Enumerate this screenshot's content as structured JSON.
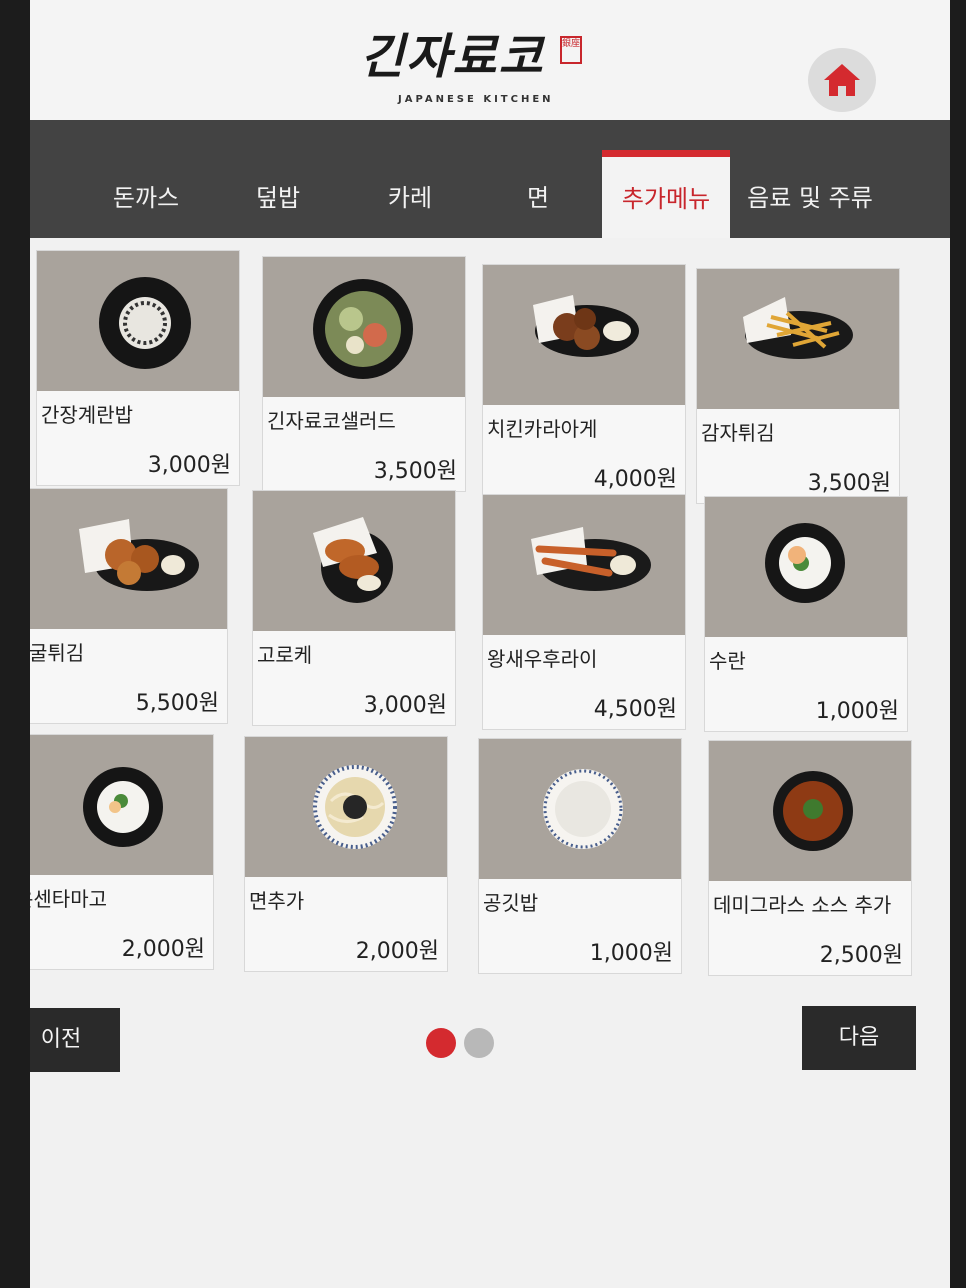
{
  "header": {
    "logo_text": "긴자료코",
    "logo_subtitle": "JAPANESE KITCHEN",
    "logo_stamp": "銀座"
  },
  "tabs": [
    {
      "label": "돈까스",
      "active": false
    },
    {
      "label": "덮밥",
      "active": false
    },
    {
      "label": "카레",
      "active": false
    },
    {
      "label": "면",
      "active": false
    },
    {
      "label": "추가메뉴",
      "active": true
    },
    {
      "label": "음료 및 주류",
      "active": false
    }
  ],
  "menu_items": [
    {
      "name": "간장계란밥",
      "price": "3,000원",
      "icon": "rice-bowl-icon"
    },
    {
      "name": "긴자료코샐러드",
      "price": "3,500원",
      "icon": "salad-bowl-icon"
    },
    {
      "name": "치킨카라아게",
      "price": "4,000원",
      "icon": "fried-chicken-icon"
    },
    {
      "name": "감자튀김",
      "price": "3,500원",
      "icon": "fries-icon"
    },
    {
      "name": "굴튀김",
      "price": "5,500원",
      "icon": "fried-oyster-icon"
    },
    {
      "name": "고로케",
      "price": "3,000원",
      "icon": "croquette-icon"
    },
    {
      "name": "왕새우후라이",
      "price": "4,500원",
      "icon": "fried-shrimp-icon"
    },
    {
      "name": "수란",
      "price": "1,000원",
      "icon": "poached-egg-icon"
    },
    {
      "name": "온센타마고",
      "price": "2,000원",
      "icon": "onsen-egg-icon"
    },
    {
      "name": "면추가",
      "price": "2,000원",
      "icon": "noodle-bowl-icon"
    },
    {
      "name": "공깃밥",
      "price": "1,000원",
      "icon": "rice-bowl-icon"
    },
    {
      "name": "데미그라스 소스 추가",
      "price": "2,500원",
      "icon": "sauce-bowl-icon"
    }
  ],
  "pagination": {
    "prev_label": "이전",
    "next_label": "다음",
    "current_page": 1,
    "total_pages": 2
  },
  "colors": {
    "accent": "#d42a2f",
    "tabbar": "#434343",
    "button": "#2a2a2a",
    "dot_active": "#d42a2f",
    "dot_inactive": "#b8b8b8"
  }
}
